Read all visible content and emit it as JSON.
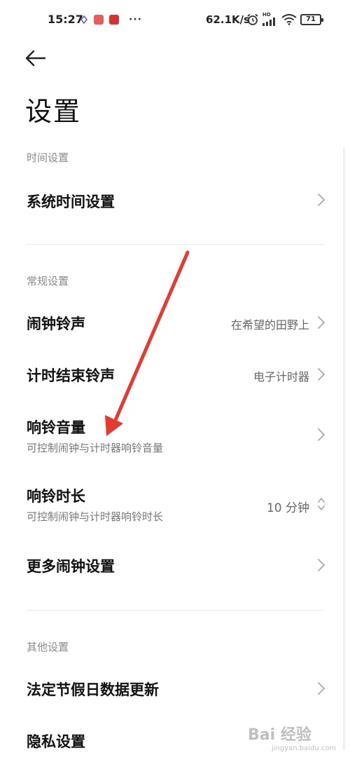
{
  "status_bar": {
    "time": "15:27",
    "more": "···",
    "net_speed": "62.1K/s",
    "hd_label": "HD",
    "battery": "71"
  },
  "header": {
    "title": "设置"
  },
  "sections": {
    "time": {
      "label": "时间设置",
      "items": [
        {
          "title": "系统时间设置"
        }
      ]
    },
    "general": {
      "label": "常规设置",
      "items": [
        {
          "title": "闹钟铃声",
          "value": "在希望的田野上"
        },
        {
          "title": "计时结束铃声",
          "value": "电子计时器"
        },
        {
          "title": "响铃音量",
          "subtitle": "可控制闹钟与计时器响铃音量"
        },
        {
          "title": "响铃时长",
          "subtitle": "可控制闹钟与计时器响铃时长",
          "value": "10 分钟"
        },
        {
          "title": "更多闹钟设置"
        }
      ]
    },
    "other": {
      "label": "其他设置",
      "items": [
        {
          "title": "法定节假日数据更新"
        },
        {
          "title": "隐私设置"
        }
      ]
    }
  },
  "annotation": {
    "arrow_color": "#e63a2e"
  },
  "watermark": {
    "text": "Bai 经验",
    "sub": "jingyan.baidu.com"
  },
  "colors": {
    "app_icon_1": "#e85c5c",
    "app_icon_2": "#d93030"
  }
}
